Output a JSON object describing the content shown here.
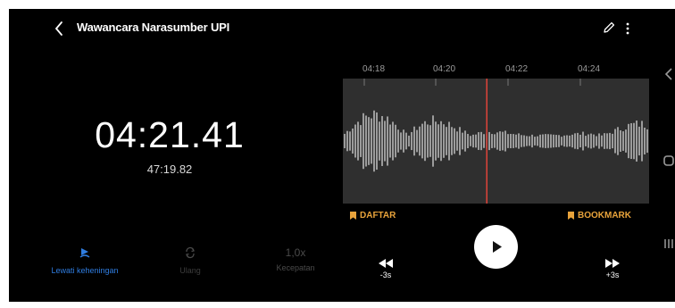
{
  "header": {
    "title": "Wawancara Narasumber UPI"
  },
  "player": {
    "current_time": "04:21.41",
    "total_duration": "47:19.82",
    "playhead_fraction": 0.47
  },
  "timeline": {
    "ticks": [
      "04:18",
      "04:20",
      "04:22",
      "04:24"
    ]
  },
  "markers": {
    "list_label": "DAFTAR",
    "bookmark_label": "BOOKMARK"
  },
  "controls": {
    "skip_silence_label": "Lewati keheningan",
    "repeat_label": "Ulang",
    "speed_value": "1,0x",
    "speed_label": "Kecepatan",
    "rewind_label": "-3s",
    "forward_label": "+3s"
  },
  "colors": {
    "accent_orange": "#e8a33b",
    "active_blue": "#2f7de1",
    "playhead_red": "#e0443a",
    "wave_panel": "#2f2f2f"
  },
  "icons": [
    "back-icon",
    "pencil-icon",
    "more-icon",
    "bookmark-icon",
    "skip-silence-icon",
    "repeat-icon",
    "rewind-icon",
    "play-icon",
    "fast-forward-icon",
    "nav-back-icon",
    "nav-home-icon",
    "nav-recents-icon"
  ]
}
